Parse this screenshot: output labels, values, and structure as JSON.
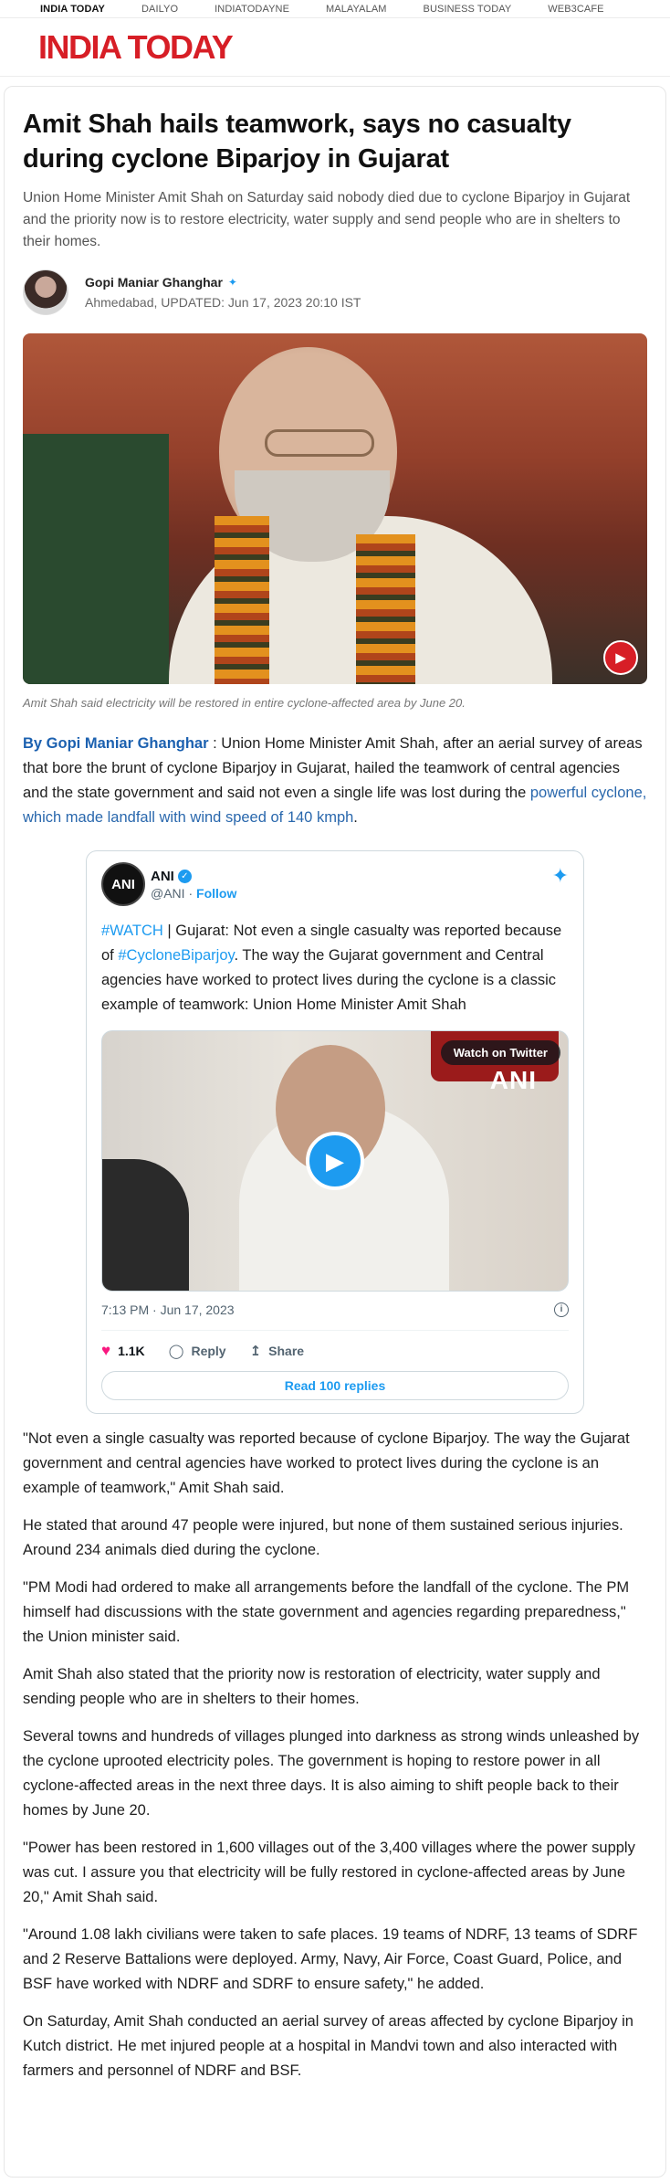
{
  "topnav": [
    "INDIA TODAY",
    "DAILYO",
    "INDIATODAYNE",
    "MALAYALAM",
    "BUSINESS TODAY",
    "WEB3CAFE"
  ],
  "brand": "INDIA TODAY",
  "article": {
    "headline": "Amit Shah hails teamwork, says no casualty during cyclone Biparjoy in Gujarat",
    "standfirst": "Union Home Minister Amit Shah on Saturday said nobody died due to cyclone Biparjoy in Gujarat and the priority now is to restore electricity, water supply and send people who are in shelters to their homes.",
    "author": "Gopi Maniar Ghanghar",
    "location": "Ahmedabad,",
    "updated": "UPDATED: Jun 17, 2023 20:10 IST",
    "caption": "Amit Shah said electricity will be restored in entire cyclone-affected area by June 20.",
    "lead_by": "By Gopi Maniar Ghanghar",
    "lead_text": " : Union Home Minister Amit Shah, after an aerial survey of areas that bore the brunt of cyclone Biparjoy in Gujarat, hailed the teamwork of central agencies and the state government and said not even a single life was lost during the ",
    "lead_link": "powerful cyclone, which made landfall with wind speed of 140 kmph",
    "lead_end": ".",
    "paragraphs": [
      "\"Not even a single casualty was reported because of cyclone Biparjoy. The way the Gujarat government and central agencies have worked to protect lives during the cyclone is an example of teamwork,\" Amit Shah said.",
      "He stated that around 47 people were injured, but none of them sustained serious injuries. Around 234 animals died during the cyclone.",
      "\"PM Modi had ordered to make all arrangements before the landfall of the cyclone. The PM himself had discussions with the state government and agencies regarding preparedness,\" the Union minister said.",
      "Amit Shah also stated that the priority now is restoration of electricity, water supply and sending people who are in shelters to their homes.",
      "Several towns and hundreds of villages plunged into darkness as strong winds unleashed by the cyclone uprooted electricity poles. The government is hoping to restore power in all cyclone-affected areas in the next three days. It is also aiming to shift people back to their homes by June 20.",
      "\"Power has been restored in 1,600 villages out of the 3,400 villages where the power supply was cut. I assure you that electricity will be fully restored in cyclone-affected areas by June 20,\" Amit Shah said.",
      "\"Around 1.08 lakh civilians were taken to safe places. 19 teams of NDRF, 13 teams of SDRF and 2 Reserve Battalions were deployed. Army, Navy, Air Force, Coast Guard, Police, and BSF have worked with NDRF and SDRF to ensure safety,\" he added.",
      "On Saturday, Amit Shah conducted an aerial survey of areas affected by cyclone Biparjoy in Kutch district. He met injured people at a hospital in Mandvi town and also interacted with farmers and personnel of NDRF and BSF."
    ]
  },
  "tweet": {
    "name": "ANI",
    "handle": "@ANI",
    "follow": "Follow",
    "hash1": "#WATCH",
    "text1": " | Gujarat: Not even a single casualty was reported because of ",
    "hash2": "#CycloneBiparjoy",
    "text2": ". The way the Gujarat government and Central agencies have worked to protect lives during the cyclone is a classic example of teamwork: Union Home Minister Amit Shah",
    "watch": "Watch on Twitter",
    "watermark": "ANI",
    "time": "7:13 PM · Jun 17, 2023",
    "likes": "1.1K",
    "reply": "Reply",
    "share": "Share",
    "read_replies": "Read 100 replies"
  },
  "icons": {
    "verified": "verified-badge-icon",
    "bird": "twitter-bird-icon",
    "play": "play-icon",
    "heart": "heart-icon",
    "reply": "reply-icon",
    "share": "share-icon",
    "info": "info-icon"
  },
  "colors": {
    "brand_red": "#d71e26",
    "twitter_blue": "#1d9bf0",
    "link_blue": "#2a68ad"
  }
}
